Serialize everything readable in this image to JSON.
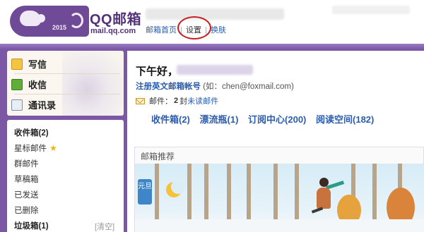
{
  "header": {
    "brand_title": "QQ邮箱",
    "brand_domain": "mail.qq.com",
    "logo_year": "2015",
    "links": {
      "home": "邮箱首页",
      "separator": "|",
      "settings": "设置",
      "skin": "换肤"
    }
  },
  "nav": {
    "actions": [
      {
        "label": "写信",
        "icon": "pencil-paper-icon"
      },
      {
        "label": "收信",
        "icon": "inbox-download-icon"
      },
      {
        "label": "通讯录",
        "icon": "contact-card-icon"
      }
    ],
    "folders": [
      {
        "label": "收件箱(2)",
        "bold": true
      },
      {
        "label": "星标邮件",
        "star": "★"
      },
      {
        "label": "群邮件"
      },
      {
        "label": "草稿箱"
      },
      {
        "label": "已发送"
      },
      {
        "label": "已删除"
      },
      {
        "label": "垃圾箱(1)",
        "bold": true
      }
    ],
    "clear_label": "[清空]"
  },
  "main": {
    "greeting": "下午好，",
    "register_link": "注册英文邮箱帐号",
    "register_hint": "(如：chen@foxmail.com)",
    "mail_prefix": "邮件：",
    "mail_count": "2",
    "mail_unit": "封",
    "mail_unread_label": "未读邮件",
    "quick_links": [
      "收件箱(2)",
      "漂流瓶(1)",
      "订阅中心(200)",
      "阅读空间(182)"
    ],
    "recommend_title": "邮箱推荐",
    "banner_badge": "元旦"
  },
  "colors": {
    "frame": "#7b57a6",
    "brand": "#53327a",
    "link": "#2a5db0",
    "highlight_circle": "#c82020"
  }
}
